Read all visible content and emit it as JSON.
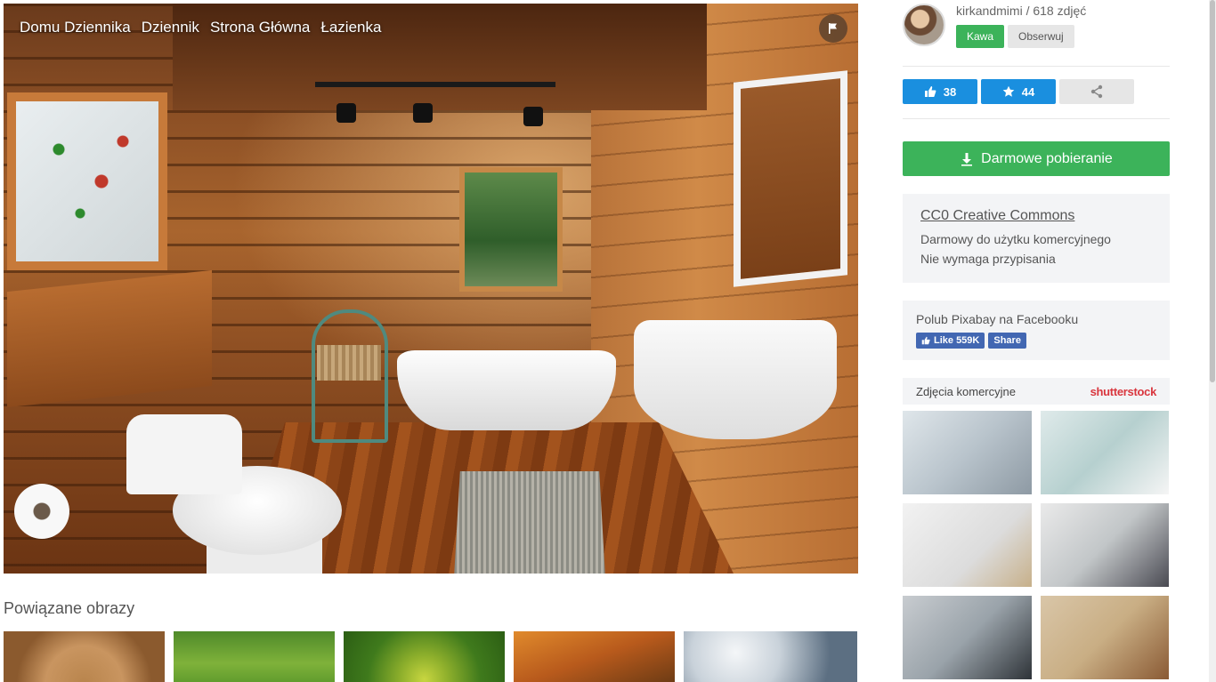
{
  "breadcrumbs": [
    "Domu Dziennika",
    "Dziennik",
    "Strona Główna",
    "Łazienka"
  ],
  "icons": {
    "flag": "flag-icon",
    "like": "thumbs-up-icon",
    "favorite": "star-icon",
    "share": "share-icon",
    "download": "download-icon"
  },
  "author": {
    "name": "kirkandmimi",
    "photos": "618 zdjęć",
    "separator": " / ",
    "coffee_label": "Kawa",
    "follow_label": "Obserwuj"
  },
  "actions": {
    "likes": "38",
    "favorites": "44"
  },
  "download": {
    "label": "Darmowe pobieranie"
  },
  "license": {
    "title": "CC0 Creative Commons",
    "line1": "Darmowy do użytku komercyjnego",
    "line2": "Nie wymaga przypisania"
  },
  "facebook": {
    "text": "Polub Pixabay na Facebooku",
    "like_label": "Like 559K",
    "share_label": "Share"
  },
  "commercial": {
    "title": "Zdjęcia komercyjne",
    "sponsor": "shutterstock"
  },
  "related": {
    "title": "Powiązane obrazy"
  },
  "colors": {
    "green": "#3cb35a",
    "blue": "#1a8fdf",
    "facebook": "#4267b2",
    "shutterstock": "#d9363e"
  }
}
